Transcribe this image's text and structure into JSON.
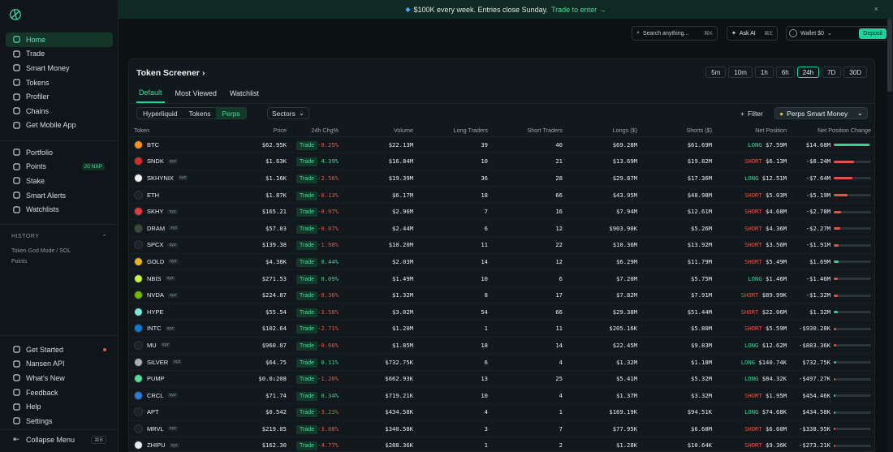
{
  "sidebar": {
    "main": [
      {
        "label": "Home",
        "icon": "home-icon",
        "active": true
      },
      {
        "label": "Trade",
        "icon": "trade-icon"
      },
      {
        "label": "Smart Money",
        "icon": "smart-money-icon"
      },
      {
        "label": "Tokens",
        "icon": "tokens-icon"
      },
      {
        "label": "Profiler",
        "icon": "profiler-icon"
      },
      {
        "label": "Chains",
        "icon": "chains-icon"
      },
      {
        "label": "Get Mobile App",
        "icon": "mobile-icon"
      }
    ],
    "secondary": [
      {
        "label": "Portfolio",
        "icon": "portfolio-icon"
      },
      {
        "label": "Points",
        "icon": "points-icon",
        "badge": "20 NXP"
      },
      {
        "label": "Stake",
        "icon": "stake-icon"
      },
      {
        "label": "Smart Alerts",
        "icon": "bell-icon"
      },
      {
        "label": "Watchlists",
        "icon": "watchlist-icon"
      }
    ],
    "history_label": "HISTORY",
    "history_items": [
      "Token God Mode / SOL",
      "Points"
    ],
    "bottom": [
      {
        "label": "Get Started",
        "icon": "get-started-icon",
        "dot": true
      },
      {
        "label": "Nansen API",
        "icon": "api-icon"
      },
      {
        "label": "What's New",
        "icon": "whats-new-icon"
      },
      {
        "label": "Feedback",
        "icon": "feedback-icon"
      },
      {
        "label": "Help",
        "icon": "help-icon"
      },
      {
        "label": "Settings",
        "icon": "gear-icon"
      }
    ],
    "collapse_label": "Collapse Menu",
    "collapse_kbd": "⌘B"
  },
  "banner": {
    "text": "$100K every week. Entries close Sunday.",
    "link": "Trade to enter →",
    "close": "×"
  },
  "topbar": {
    "search_placeholder": "Search anything...",
    "search_kbd": "⌘K",
    "ask_ai": "Ask AI",
    "ask_kbd": "⌘E",
    "wallet": "Wallet $0",
    "deposit": "Deposit"
  },
  "panel": {
    "title": "Token Screener",
    "timeframes": [
      "5m",
      "10m",
      "1h",
      "6h",
      "24h",
      "7D",
      "30D"
    ],
    "active_timeframe": "24h",
    "tabs": [
      "Default",
      "Most Viewed",
      "Watchlist"
    ],
    "segments": [
      "Hyperliquid",
      "Tokens",
      "Perps"
    ],
    "sectors": "Sectors",
    "filter": "Filter",
    "smart_money": "Perps Smart Money"
  },
  "columns": [
    "Token",
    "Price",
    "24h Chg%",
    "Volume",
    "Long Traders",
    "Short Traders",
    "Longs ($)",
    "Shorts ($)",
    "Net Position",
    "Net Position Change"
  ],
  "rows": [
    {
      "token": "BTC",
      "xyz": false,
      "color": "#f7931a",
      "price": "$62.95K",
      "chg": "-0.25%",
      "vol": "$22.13M",
      "lt": "39",
      "st": "40",
      "longs": "$69.28M",
      "shorts": "$61.69M",
      "side": "LONG",
      "net": "$7.59M",
      "npc": "$14.68M",
      "fill": 0.95
    },
    {
      "token": "SNDK",
      "xyz": true,
      "color": "#d52b2b",
      "price": "$1.63K",
      "chg": "4.39%",
      "vol": "$16.84M",
      "lt": "10",
      "st": "21",
      "longs": "$13.69M",
      "shorts": "$19.82M",
      "side": "SHORT",
      "net": "$6.13M",
      "npc": "-$8.24M",
      "fill": 0.55
    },
    {
      "token": "SKHYNIX",
      "xyz": true,
      "color": "#f2f2f2",
      "price": "$1.16K",
      "chg": "-2.56%",
      "vol": "$19.39M",
      "lt": "36",
      "st": "28",
      "longs": "$29.87M",
      "shorts": "$17.36M",
      "side": "LONG",
      "net": "$12.51M",
      "npc": "-$7.64M",
      "fill": 0.5
    },
    {
      "token": "ETH",
      "xyz": false,
      "color": "#1c2225",
      "price": "$1.87K",
      "chg": "-0.13%",
      "vol": "$6.17M",
      "lt": "18",
      "st": "66",
      "longs": "$43.95M",
      "shorts": "$48.98M",
      "side": "SHORT",
      "net": "$5.03M",
      "npc": "-$5.19M",
      "fill": 0.38
    },
    {
      "token": "SKHY",
      "xyz": true,
      "color": "#e03a3a",
      "price": "$165.21",
      "chg": "-0.97%",
      "vol": "$2.96M",
      "lt": "7",
      "st": "16",
      "longs": "$7.94M",
      "shorts": "$12.61M",
      "side": "SHORT",
      "net": "$4.68M",
      "npc": "-$2.78M",
      "fill": 0.2
    },
    {
      "token": "DRAM",
      "xyz": true,
      "color": "#3a4a3a",
      "price": "$57.03",
      "chg": "-0.07%",
      "vol": "$2.44M",
      "lt": "6",
      "st": "12",
      "longs": "$903.90K",
      "shorts": "$5.26M",
      "side": "SHORT",
      "net": "$4.36M",
      "npc": "-$2.27M",
      "fill": 0.17
    },
    {
      "token": "SPCX",
      "xyz": true,
      "color": "#1c2225",
      "price": "$139.38",
      "chg": "-1.98%",
      "vol": "$10.20M",
      "lt": "11",
      "st": "22",
      "longs": "$10.36M",
      "shorts": "$13.92M",
      "side": "SHORT",
      "net": "$3.56M",
      "npc": "-$1.91M",
      "fill": 0.14
    },
    {
      "token": "GOLD",
      "xyz": true,
      "color": "#e8b424",
      "price": "$4.38K",
      "chg": "0.44%",
      "vol": "$2.03M",
      "lt": "14",
      "st": "12",
      "longs": "$6.29M",
      "shorts": "$11.79M",
      "side": "SHORT",
      "net": "$5.49M",
      "npc": "$1.69M",
      "fill": 0.12
    },
    {
      "token": "NBIS",
      "xyz": true,
      "color": "#c7f24a",
      "price": "$271.53",
      "chg": "0.09%",
      "vol": "$1.49M",
      "lt": "10",
      "st": "6",
      "longs": "$7.20M",
      "shorts": "$5.75M",
      "side": "LONG",
      "net": "$1.46M",
      "npc": "-$1.46M",
      "fill": 0.11
    },
    {
      "token": "NVDA",
      "xyz": true,
      "color": "#76b900",
      "price": "$224.87",
      "chg": "-0.36%",
      "vol": "$1.32M",
      "lt": "8",
      "st": "17",
      "longs": "$7.82M",
      "shorts": "$7.91M",
      "side": "SHORT",
      "net": "$89.99K",
      "npc": "-$1.32M",
      "fill": 0.1
    },
    {
      "token": "HYPE",
      "xyz": false,
      "color": "#7be7d5",
      "price": "$55.54",
      "chg": "-3.58%",
      "vol": "$3.02M",
      "lt": "54",
      "st": "66",
      "longs": "$29.38M",
      "shorts": "$51.44M",
      "side": "SHORT",
      "net": "$22.06M",
      "npc": "$1.32M",
      "fill": 0.1
    },
    {
      "token": "INTC",
      "xyz": true,
      "color": "#0a7bd6",
      "price": "$102.64",
      "chg": "-2.71%",
      "vol": "$1.20M",
      "lt": "1",
      "st": "11",
      "longs": "$205.16K",
      "shorts": "$5.80M",
      "side": "SHORT",
      "net": "$5.59M",
      "npc": "-$930.28K",
      "fill": 0.07
    },
    {
      "token": "MU",
      "xyz": true,
      "color": "#1c2225",
      "price": "$960.07",
      "chg": "-0.66%",
      "vol": "$1.85M",
      "lt": "18",
      "st": "14",
      "longs": "$22.45M",
      "shorts": "$9.83M",
      "side": "LONG",
      "net": "$12.62M",
      "npc": "-$883.36K",
      "fill": 0.07
    },
    {
      "token": "SILVER",
      "xyz": true,
      "color": "#a8b0b4",
      "price": "$64.75",
      "chg": "0.11%",
      "vol": "$732.75K",
      "lt": "6",
      "st": "4",
      "longs": "$1.32M",
      "shorts": "$1.18M",
      "side": "LONG",
      "net": "$140.74K",
      "npc": "$732.75K",
      "fill": 0.06
    },
    {
      "token": "PUMP",
      "xyz": false,
      "color": "#5ed99a",
      "price": "$0.0₂208",
      "chg": "-1.20%",
      "vol": "$662.93K",
      "lt": "13",
      "st": "25",
      "longs": "$5.41M",
      "shorts": "$5.32M",
      "side": "LONG",
      "net": "$84.32K",
      "npc": "-$497.27K",
      "fill": 0.05
    },
    {
      "token": "CRCL",
      "xyz": true,
      "color": "#2f7bd9",
      "price": "$71.74",
      "chg": "0.34%",
      "vol": "$719.21K",
      "lt": "10",
      "st": "4",
      "longs": "$1.37M",
      "shorts": "$3.32M",
      "side": "SHORT",
      "net": "$1.95M",
      "npc": "$454.46K",
      "fill": 0.05
    },
    {
      "token": "APT",
      "xyz": false,
      "color": "#1c2225",
      "price": "$0.542",
      "chg": "-3.23%",
      "vol": "$434.58K",
      "lt": "4",
      "st": "1",
      "longs": "$169.19K",
      "shorts": "$94.51K",
      "side": "LONG",
      "net": "$74.68K",
      "npc": "$434.58K",
      "fill": 0.05
    },
    {
      "token": "MRVL",
      "xyz": true,
      "color": "#1c2225",
      "price": "$219.05",
      "chg": "-3.08%",
      "vol": "$340.58K",
      "lt": "3",
      "st": "7",
      "longs": "$77.95K",
      "shorts": "$6.68M",
      "side": "SHORT",
      "net": "$6.60M",
      "npc": "-$338.95K",
      "fill": 0.04
    },
    {
      "token": "ZHIPU",
      "xyz": true,
      "color": "#e6ecef",
      "price": "$162.30",
      "chg": "-4.77%",
      "vol": "$288.36K",
      "lt": "1",
      "st": "2",
      "longs": "$1.28K",
      "shorts": "$10.64K",
      "side": "SHORT",
      "net": "$9.36K",
      "npc": "-$273.21K",
      "fill": 0.04
    }
  ],
  "colors": {
    "accent": "#1ad49a",
    "positive": "#3ccf91",
    "negative": "#e0554a",
    "background": "#0c1114"
  }
}
